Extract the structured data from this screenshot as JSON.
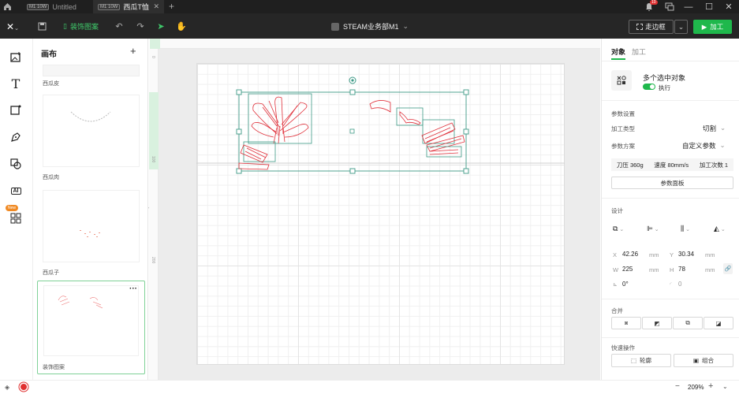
{
  "titlebar": {
    "tab1": {
      "chip": "M1 10W",
      "title": "Untitled"
    },
    "tab2": {
      "chip": "M1 10W",
      "title": "西瓜T恤"
    },
    "add": "+",
    "notif_count": "10"
  },
  "toolbar": {
    "pattern_label": "装饰图案",
    "device_name": "STEAM业务部M1",
    "frame_label": "走边框",
    "process_label": "加工"
  },
  "layers": {
    "header": "画布",
    "items": [
      {
        "label": "西瓜皮"
      },
      {
        "label": "西瓜肉"
      },
      {
        "label": "西瓜子"
      },
      {
        "label": "装饰图案"
      }
    ],
    "new_badge": "New"
  },
  "ruler": {
    "left_marks": [
      "0",
      "100",
      "200"
    ]
  },
  "right": {
    "tab_object": "对象",
    "tab_process": "加工",
    "multi_title": "多个选中对象",
    "execute_label": "执行",
    "params_header": "参数设置",
    "proc_type_label": "加工类型",
    "proc_type_value": "切割",
    "scheme_label": "参数方案",
    "scheme_value": "自定义参数",
    "pressure": "刀压 360g",
    "speed": "速度 80mm/s",
    "times": "加工次数 1",
    "panel_btn": "参数面板",
    "design_header": "设计",
    "x_label": "X",
    "x_val": "42.26",
    "x_unit": "mm",
    "y_label": "Y",
    "y_val": "30.34",
    "y_unit": "mm",
    "w_label": "W",
    "w_val": "225",
    "w_unit": "mm",
    "h_label": "H",
    "h_val": "78",
    "h_unit": "mm",
    "rot_val": "0°",
    "corner_val": "0",
    "merge_header": "合并",
    "quick_header": "快速操作",
    "outline_btn": "轮廓",
    "group_btn": "组合"
  },
  "status": {
    "zoom": "209%",
    "minus": "−",
    "plus": "+"
  },
  "colors": {
    "accent": "#1fb84c",
    "selection": "#3d9a86",
    "stroke": "#e0303a"
  }
}
